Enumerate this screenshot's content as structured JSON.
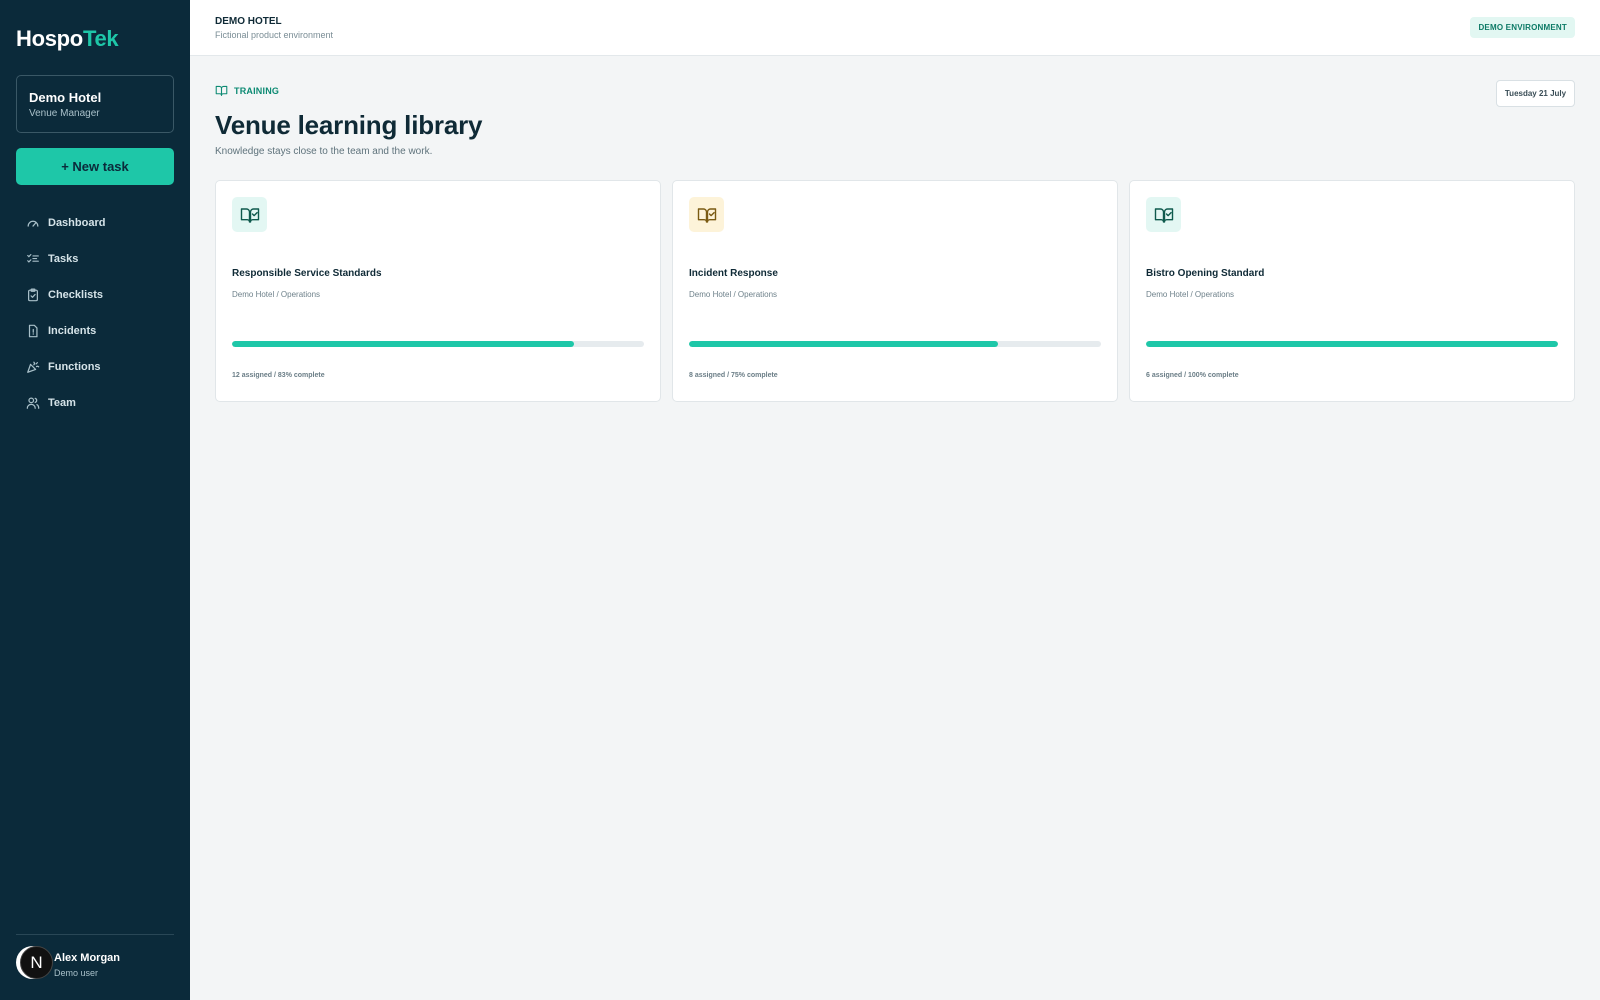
{
  "brand": {
    "part1": "Hospo",
    "part2": "Tek",
    "accent_color": "#1ec7a8"
  },
  "sidebar": {
    "venue": {
      "name": "Demo Hotel",
      "role": "Venue Manager"
    },
    "new_task_label": "+ New task",
    "items": [
      {
        "label": "Dashboard",
        "icon": "gauge-icon"
      },
      {
        "label": "Tasks",
        "icon": "list-check-icon"
      },
      {
        "label": "Checklists",
        "icon": "clipboard-check-icon"
      },
      {
        "label": "Incidents",
        "icon": "file-alert-icon"
      },
      {
        "label": "Functions",
        "icon": "party-popper-icon"
      },
      {
        "label": "Team",
        "icon": "users-icon"
      }
    ],
    "user": {
      "initial": "N",
      "name": "Alex Morgan",
      "subtitle": "Demo user"
    }
  },
  "topbar": {
    "title": "DEMO HOTEL",
    "subtitle": "Fictional product environment",
    "badge": "DEMO ENVIRONMENT"
  },
  "page": {
    "eyebrow": "TRAINING",
    "date": "Tuesday 21 July",
    "title": "Venue learning library",
    "subtitle": "Knowledge stays close to the team and the work."
  },
  "cards": [
    {
      "title": "Responsible Service Standards",
      "meta": "Demo Hotel / Operations",
      "progress": 0.83,
      "stats": "12 assigned / 83% complete",
      "icon": "book-check-icon",
      "icon_bg": "#e3f7f3",
      "icon_color": "#0f5a4d"
    },
    {
      "title": "Incident Response",
      "meta": "Demo Hotel / Operations",
      "progress": 0.75,
      "stats": "8 assigned / 75% complete",
      "icon": "book-check-icon",
      "icon_bg": "#fdf3d9",
      "icon_color": "#7a5a12"
    },
    {
      "title": "Bistro Opening Standard",
      "meta": "Demo Hotel / Operations",
      "progress": 1.0,
      "stats": "6 assigned / 100% complete",
      "icon": "book-check-icon",
      "icon_bg": "#e3f7f3",
      "icon_color": "#0f5a4d"
    }
  ]
}
